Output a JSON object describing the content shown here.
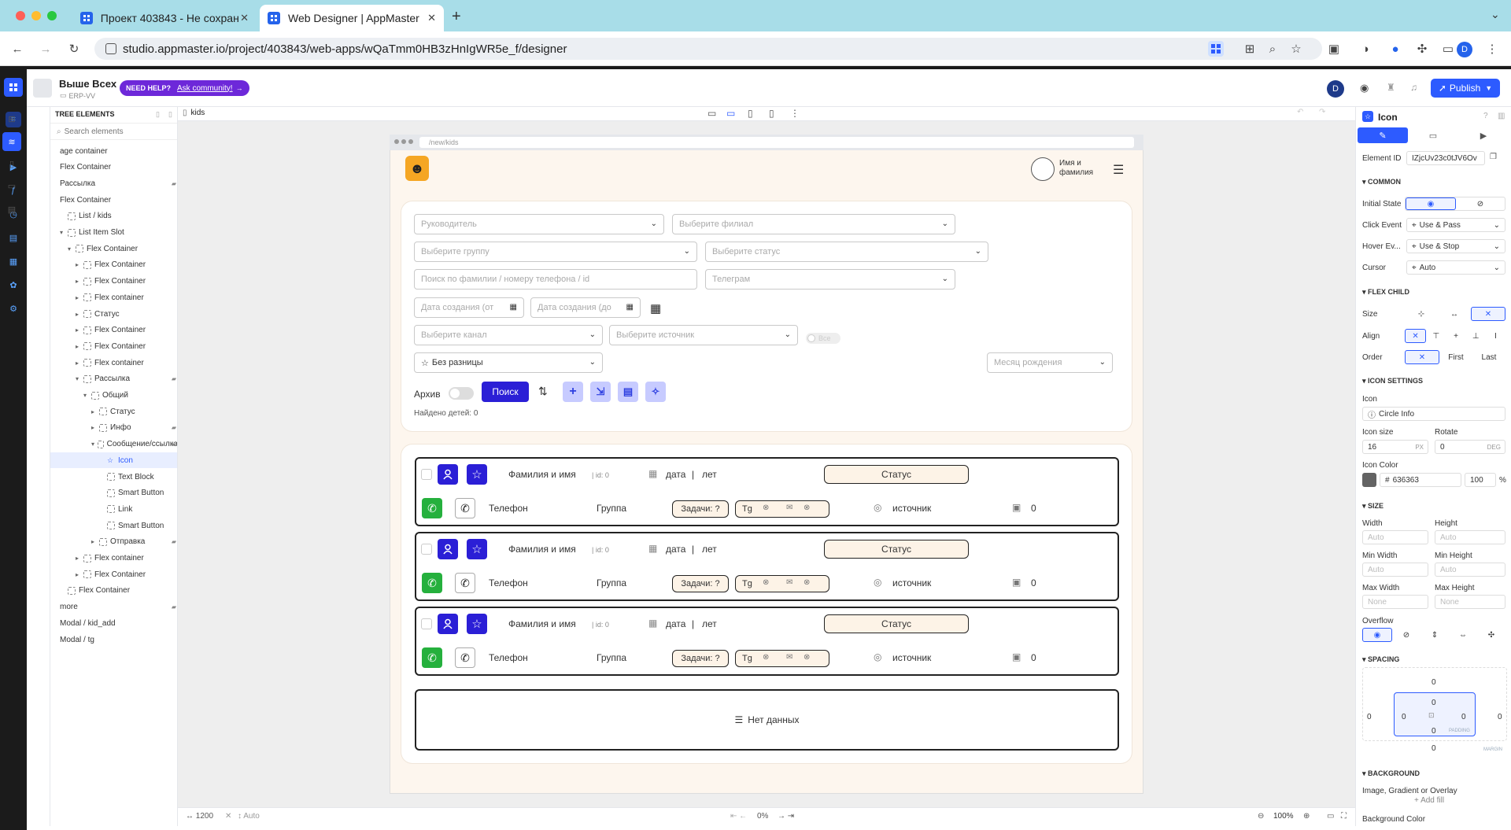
{
  "browser": {
    "tabs": [
      {
        "title": "Проект 403843 - Не сохран"
      },
      {
        "title": "Web Designer | AppMaster"
      }
    ],
    "url": "studio.appmaster.io/project/403843/web-apps/wQaTmm0HB3zHnIgWR5e_f/designer",
    "profile": "D"
  },
  "app": {
    "project_name": "Выше Всех",
    "project_sub": "ERP-VV",
    "help_badge": "NEED HELP?",
    "help_link": "Ask community!",
    "user_initial": "D",
    "publish_label": "Publish",
    "accent": "#2d5bff"
  },
  "tree": {
    "title": "TREE ELEMENTS",
    "search_placeholder": "Search elements",
    "page_tab": "kids",
    "items": [
      {
        "label": "age container",
        "indent": 0,
        "chev": ""
      },
      {
        "label": "Flex Container",
        "indent": 0,
        "chev": ""
      },
      {
        "label": "Рассылка",
        "indent": 0,
        "chev": ""
      },
      {
        "label": "Flex Container",
        "indent": 0,
        "chev": ""
      },
      {
        "label": "List / kids",
        "indent": 1,
        "chev": ""
      },
      {
        "label": "List Item Slot",
        "indent": 1,
        "chev": "v"
      },
      {
        "label": "Flex Container",
        "indent": 2,
        "chev": "v"
      },
      {
        "label": "Flex Container",
        "indent": 3,
        "chev": ">"
      },
      {
        "label": "Flex Container",
        "indent": 3,
        "chev": ">"
      },
      {
        "label": "Flex container",
        "indent": 3,
        "chev": ">"
      },
      {
        "label": "Статус",
        "indent": 3,
        "chev": ">"
      },
      {
        "label": "Flex Container",
        "indent": 3,
        "chev": ">"
      },
      {
        "label": "Flex Container",
        "indent": 3,
        "chev": ">"
      },
      {
        "label": "Flex container",
        "indent": 3,
        "chev": ">"
      },
      {
        "label": "Рассылка",
        "indent": 3,
        "chev": "v"
      },
      {
        "label": "Общий",
        "indent": 4,
        "chev": "v"
      },
      {
        "label": "Статус",
        "indent": 5,
        "chev": ">"
      },
      {
        "label": "Инфо",
        "indent": 5,
        "chev": ">"
      },
      {
        "label": "Сообщение/ссылка",
        "indent": 5,
        "chev": "v"
      },
      {
        "label": "Icon",
        "indent": 6,
        "chev": ""
      },
      {
        "label": "Text Block",
        "indent": 6,
        "chev": ""
      },
      {
        "label": "Smart Button",
        "indent": 6,
        "chev": ""
      },
      {
        "label": "Link",
        "indent": 6,
        "chev": ""
      },
      {
        "label": "Smart Button",
        "indent": 6,
        "chev": ""
      },
      {
        "label": "Отправка",
        "indent": 5,
        "chev": ">"
      },
      {
        "label": "Flex container",
        "indent": 3,
        "chev": ">"
      },
      {
        "label": "Flex Container",
        "indent": 3,
        "chev": ">"
      },
      {
        "label": "Flex Container",
        "indent": 1,
        "chev": ""
      },
      {
        "label": "more",
        "indent": 0,
        "chev": ""
      },
      {
        "label": "Modal / kid_add",
        "indent": 0,
        "chev": ""
      },
      {
        "label": "Modal / tg",
        "indent": 0,
        "chev": ""
      }
    ]
  },
  "canvas": {
    "page_url": "/new/kids",
    "user_name": "Имя и\nфамилия",
    "filters": {
      "manager": "Руководитель",
      "branch": "Выберите филиал",
      "group": "Выберите группу",
      "status": "Выберите статус",
      "search": "Поиск по фамилии / номеру телефона / id",
      "telegram": "Телеграм",
      "date_from": "Дата создания (от",
      "date_to": "Дата создания (до",
      "channel": "Выберите канал",
      "source": "Выберите источник",
      "all_toggle": "Все",
      "no_diff": "Без разницы",
      "birth_month": "Месяц рождения",
      "archive": "Архив",
      "search_btn": "Поиск",
      "found": "Найдено детей:",
      "found_count": "0"
    },
    "rows": [
      {
        "name": "Фамилия и имя",
        "id": "| id: 0",
        "date": "дата",
        "years": "лет",
        "status": "Статус",
        "phone": "Телефон",
        "group": "Группа",
        "tasks": "Задачи: ?",
        "tg": "Tg",
        "source": "источник",
        "count": "0"
      },
      {
        "name": "Фамилия и имя",
        "id": "| id: 0",
        "date": "дата",
        "years": "лет",
        "status": "Статус",
        "phone": "Телефон",
        "group": "Группа",
        "tasks": "Задачи: ?",
        "tg": "Tg",
        "source": "источник",
        "count": "0"
      },
      {
        "name": "Фамилия и имя",
        "id": "| id: 0",
        "date": "дата",
        "years": "лет",
        "status": "Статус",
        "phone": "Телефон",
        "group": "Группа",
        "tasks": "Задачи: ?",
        "tg": "Tg",
        "source": "источник",
        "count": "0"
      }
    ],
    "empty": "Нет данных",
    "width": "1200",
    "height": "Auto",
    "percent": "0%",
    "zoom": "100%"
  },
  "panel": {
    "title": "Icon",
    "element_id_label": "Element ID",
    "element_id": "IZjcUv23c0tJV6Ov",
    "common": "COMMON",
    "initial_state": "Initial State",
    "click_event": "Click Event",
    "click_value": "Use & Pass",
    "hover_event": "Hover Ev...",
    "hover_value": "Use & Stop",
    "cursor": "Cursor",
    "cursor_value": "Auto",
    "flex_child": "FLEX CHILD",
    "size": "Size",
    "align": "Align",
    "order": "Order",
    "order_first": "First",
    "order_last": "Last",
    "icon_settings": "ICON SETTINGS",
    "icon_label": "Icon",
    "icon_value": "Circle Info",
    "icon_size": "Icon size",
    "icon_size_value": "16",
    "px": "PX",
    "rotate": "Rotate",
    "rotate_value": "0",
    "deg": "DEG",
    "icon_color": "Icon Color",
    "color_hex": "636363",
    "color_opacity": "100",
    "pct": "%",
    "size_section": "SIZE",
    "width": "Width",
    "height": "Height",
    "min_width": "Min Width",
    "min_height": "Min Height",
    "max_width": "Max Width",
    "max_height": "Max Height",
    "auto": "Auto",
    "none": "None",
    "overflow": "Overflow",
    "spacing": "SPACING",
    "zero": "0",
    "padding": "PADDING",
    "margin": "MARGIN",
    "background": "BACKGROUND",
    "bg_sub": "Image, Gradient or Overlay",
    "add_fill": "+ Add fill",
    "bg_color": "Background Color"
  }
}
